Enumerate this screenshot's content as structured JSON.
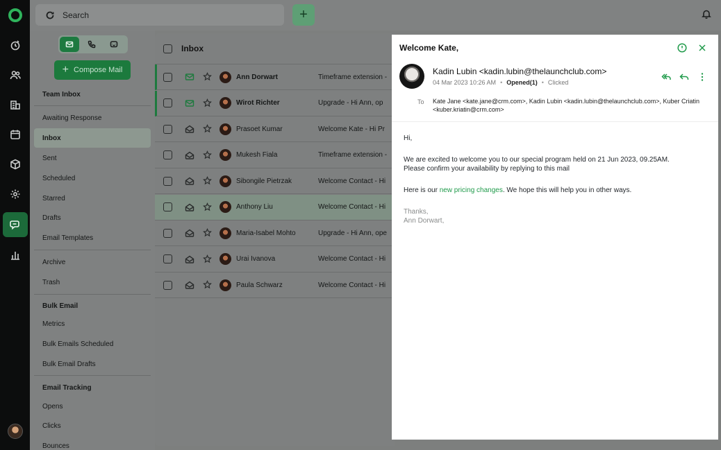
{
  "topbar": {
    "search_placeholder": "Search",
    "add_button": "+"
  },
  "nav": {
    "compose_label": "Compose Mail",
    "items": [
      {
        "label": "Team Inbox",
        "style": "head"
      },
      {
        "label": "Awaiting Response"
      },
      {
        "label": "Inbox",
        "active": true
      },
      {
        "label": "Sent"
      },
      {
        "label": "Scheduled"
      },
      {
        "label": "Starred"
      },
      {
        "label": "Drafts"
      },
      {
        "label": "Email Templates"
      },
      {
        "label": "Archive"
      },
      {
        "label": "Trash"
      },
      {
        "label": "Bulk Email",
        "style": "head"
      },
      {
        "label": "Metrics"
      },
      {
        "label": "Bulk Emails Scheduled"
      },
      {
        "label": "Bulk Email Drafts"
      },
      {
        "label": "Email Tracking",
        "style": "head"
      },
      {
        "label": "Opens"
      },
      {
        "label": "Clicks"
      },
      {
        "label": "Bounces"
      }
    ]
  },
  "list": {
    "title": "Inbox",
    "rows": [
      {
        "name": "Ann Dorwart",
        "subject": "Timeframe extension  -",
        "unread": true
      },
      {
        "name": "Wirot Richter",
        "subject": "Upgrade  -  Hi Ann, op",
        "unread": true
      },
      {
        "name": "Prasoet Kumar",
        "subject": "Welcome Kate  -  Hi Pr"
      },
      {
        "name": "Mukesh Fiala",
        "subject": "Timeframe extension  -"
      },
      {
        "name": "Sibongile Pietrzak",
        "subject": "Welcome Contact  -  Hi"
      },
      {
        "name": "Anthony Liu",
        "subject": "Welcome Contact  -  Hi",
        "selected": true
      },
      {
        "name": "Maria-Isabel Mohto",
        "subject": "Upgrade  -  Hi Ann, ope"
      },
      {
        "name": "Urai Ivanova",
        "subject": "Welcome Contact  -  Hi"
      },
      {
        "name": "Paula Schwarz",
        "subject": "Welcome Contact  -  Hi"
      }
    ]
  },
  "detail": {
    "title": "Welcome Kate,",
    "from": "Kadin Lubin <kadin.lubin@thelaunchclub.com>",
    "date": "04 Mar 2023 10:26 AM",
    "opened": "Opened(1)",
    "clicked": "Clicked",
    "to_label": "To",
    "to": "Kate Jane <kate.jane@crm.com>, Kadin Lubin <kadin.lubin@thelaunchclub.com>, Kuber Criatin <kuber.kriatin@crm.com>",
    "greeting": "Hi,",
    "para1_line1": "We are excited to welcome you to our special program held on 21 Jun 2023, 09.25AM.",
    "para1_line2": "Please confirm your availability by replying to this mail",
    "para2_before": "Here is our ",
    "para2_link": "new pricing changes",
    "para2_after": ". We hope this will help you in other ways.",
    "sign1": "Thanks,",
    "sign2": "Ann Dorwart,"
  },
  "colors": {
    "accent": "#1f9a4a",
    "rail_bg": "#0c0d0d",
    "active_rail": "#1c6a3a"
  }
}
